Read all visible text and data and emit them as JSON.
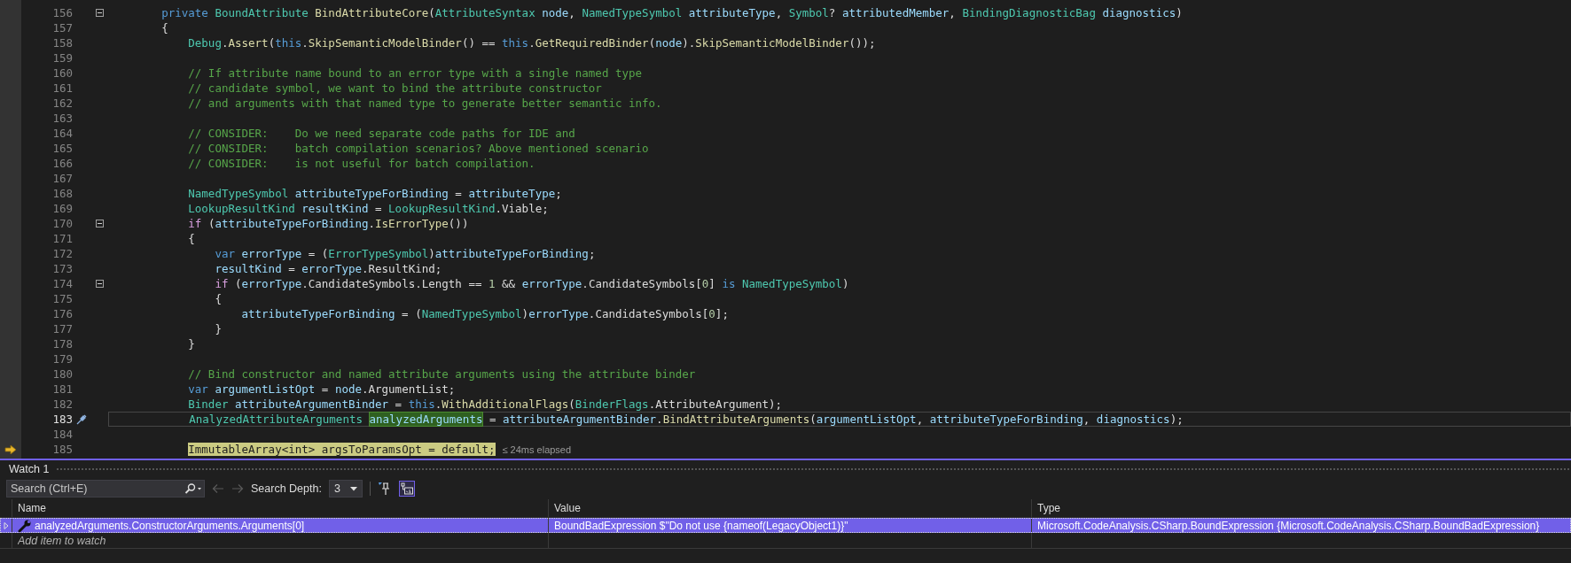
{
  "editor": {
    "lines": [
      {
        "number": "156",
        "kind": "fold",
        "tokens": [
          {
            "kind": "keyword",
            "text": "        private"
          },
          {
            "kind": "type",
            "text": " BoundAttribute"
          },
          {
            "kind": "method",
            "text": " BindAttributeCore"
          },
          {
            "kind": "plain",
            "text": "("
          },
          {
            "kind": "type",
            "text": "AttributeSyntax"
          },
          {
            "kind": "local",
            "text": " node"
          },
          {
            "kind": "plain",
            "text": ", "
          },
          {
            "kind": "type",
            "text": "NamedTypeSymbol"
          },
          {
            "kind": "local",
            "text": " attributeType"
          },
          {
            "kind": "plain",
            "text": ", "
          },
          {
            "kind": "type",
            "text": "Symbol"
          },
          {
            "kind": "plain",
            "text": "? "
          },
          {
            "kind": "local",
            "text": "attributedMember"
          },
          {
            "kind": "plain",
            "text": ", "
          },
          {
            "kind": "type",
            "text": "BindingDiagnosticBag"
          },
          {
            "kind": "local",
            "text": " diagnostics"
          },
          {
            "kind": "plain",
            "text": ")"
          }
        ]
      },
      {
        "number": "157",
        "kind": "plain",
        "tokens": [
          {
            "kind": "plain",
            "text": "        {"
          }
        ]
      },
      {
        "number": "158",
        "kind": "plain",
        "tokens": [
          {
            "kind": "type",
            "text": "            Debug"
          },
          {
            "kind": "plain",
            "text": "."
          },
          {
            "kind": "method",
            "text": "Assert"
          },
          {
            "kind": "plain",
            "text": "("
          },
          {
            "kind": "keyword",
            "text": "this"
          },
          {
            "kind": "plain",
            "text": "."
          },
          {
            "kind": "method",
            "text": "SkipSemanticModelBinder"
          },
          {
            "kind": "plain",
            "text": "() == "
          },
          {
            "kind": "keyword",
            "text": "this"
          },
          {
            "kind": "plain",
            "text": "."
          },
          {
            "kind": "method",
            "text": "GetRequiredBinder"
          },
          {
            "kind": "plain",
            "text": "("
          },
          {
            "kind": "local",
            "text": "node"
          },
          {
            "kind": "plain",
            "text": ")."
          },
          {
            "kind": "method",
            "text": "SkipSemanticModelBinder"
          },
          {
            "kind": "plain",
            "text": "());"
          }
        ]
      },
      {
        "number": "159",
        "kind": "plain"
      },
      {
        "number": "160",
        "kind": "plain",
        "tokens": [
          {
            "kind": "comment",
            "text": "            // If attribute name bound to an error type with a single named type"
          }
        ]
      },
      {
        "number": "161",
        "kind": "plain",
        "tokens": [
          {
            "kind": "comment",
            "text": "            // candidate symbol, we want to bind the attribute constructor"
          }
        ]
      },
      {
        "number": "162",
        "kind": "plain",
        "tokens": [
          {
            "kind": "comment",
            "text": "            // and arguments with that named type to generate better semantic info."
          }
        ]
      },
      {
        "number": "163",
        "kind": "plain"
      },
      {
        "number": "164",
        "kind": "plain",
        "tokens": [
          {
            "kind": "comment",
            "text": "            // CONSIDER:    Do we need separate code paths for IDE and"
          }
        ]
      },
      {
        "number": "165",
        "kind": "plain",
        "tokens": [
          {
            "kind": "comment",
            "text": "            // CONSIDER:    batch compilation scenarios? Above mentioned scenario"
          }
        ]
      },
      {
        "number": "166",
        "kind": "plain",
        "tokens": [
          {
            "kind": "comment",
            "text": "            // CONSIDER:    is not useful for batch compilation."
          }
        ]
      },
      {
        "number": "167",
        "kind": "plain"
      },
      {
        "number": "168",
        "kind": "plain",
        "tokens": [
          {
            "kind": "type",
            "text": "            NamedTypeSymbol"
          },
          {
            "kind": "local",
            "text": " attributeTypeForBinding"
          },
          {
            "kind": "plain",
            "text": " = "
          },
          {
            "kind": "local",
            "text": "attributeType"
          },
          {
            "kind": "plain",
            "text": ";"
          }
        ]
      },
      {
        "number": "169",
        "kind": "plain",
        "tokens": [
          {
            "kind": "type",
            "text": "            LookupResultKind"
          },
          {
            "kind": "local",
            "text": " resultKind"
          },
          {
            "kind": "plain",
            "text": " = "
          },
          {
            "kind": "type",
            "text": "LookupResultKind"
          },
          {
            "kind": "plain",
            "text": ".Viable;"
          }
        ]
      },
      {
        "number": "170",
        "kind": "fold",
        "tokens": [
          {
            "kind": "control",
            "text": "            if"
          },
          {
            "kind": "plain",
            "text": " ("
          },
          {
            "kind": "local",
            "text": "attributeTypeForBinding"
          },
          {
            "kind": "plain",
            "text": "."
          },
          {
            "kind": "method",
            "text": "IsErrorType"
          },
          {
            "kind": "plain",
            "text": "())"
          }
        ]
      },
      {
        "number": "171",
        "kind": "plain",
        "tokens": [
          {
            "kind": "plain",
            "text": "            {"
          }
        ]
      },
      {
        "number": "172",
        "kind": "plain",
        "tokens": [
          {
            "kind": "keyword",
            "text": "                var"
          },
          {
            "kind": "local",
            "text": " errorType"
          },
          {
            "kind": "plain",
            "text": " = ("
          },
          {
            "kind": "type",
            "text": "ErrorTypeSymbol"
          },
          {
            "kind": "plain",
            "text": ")"
          },
          {
            "kind": "local",
            "text": "attributeTypeForBinding"
          },
          {
            "kind": "plain",
            "text": ";"
          }
        ]
      },
      {
        "number": "173",
        "kind": "plain",
        "tokens": [
          {
            "kind": "local",
            "text": "                resultKind"
          },
          {
            "kind": "plain",
            "text": " = "
          },
          {
            "kind": "local",
            "text": "errorType"
          },
          {
            "kind": "plain",
            "text": ".ResultKind;"
          }
        ]
      },
      {
        "number": "174",
        "kind": "fold",
        "tokens": [
          {
            "kind": "control",
            "text": "                if"
          },
          {
            "kind": "plain",
            "text": " ("
          },
          {
            "kind": "local",
            "text": "errorType"
          },
          {
            "kind": "plain",
            "text": ".CandidateSymbols.Length == "
          },
          {
            "kind": "number",
            "text": "1"
          },
          {
            "kind": "plain",
            "text": " && "
          },
          {
            "kind": "local",
            "text": "errorType"
          },
          {
            "kind": "plain",
            "text": ".CandidateSymbols["
          },
          {
            "kind": "number",
            "text": "0"
          },
          {
            "kind": "plain",
            "text": "] "
          },
          {
            "kind": "keyword",
            "text": "is"
          },
          {
            "kind": "type",
            "text": " NamedTypeSymbol"
          },
          {
            "kind": "plain",
            "text": ")"
          }
        ]
      },
      {
        "number": "175",
        "kind": "plain",
        "tokens": [
          {
            "kind": "plain",
            "text": "                {"
          }
        ]
      },
      {
        "number": "176",
        "kind": "plain",
        "tokens": [
          {
            "kind": "local",
            "text": "                    attributeTypeForBinding"
          },
          {
            "kind": "plain",
            "text": " = ("
          },
          {
            "kind": "type",
            "text": "NamedTypeSymbol"
          },
          {
            "kind": "plain",
            "text": ")"
          },
          {
            "kind": "local",
            "text": "errorType"
          },
          {
            "kind": "plain",
            "text": ".CandidateSymbols["
          },
          {
            "kind": "number",
            "text": "0"
          },
          {
            "kind": "plain",
            "text": "];"
          }
        ]
      },
      {
        "number": "177",
        "kind": "plain",
        "tokens": [
          {
            "kind": "plain",
            "text": "                }"
          }
        ]
      },
      {
        "number": "178",
        "kind": "plain",
        "tokens": [
          {
            "kind": "plain",
            "text": "            }"
          }
        ]
      },
      {
        "number": "179",
        "kind": "plain"
      },
      {
        "number": "180",
        "kind": "plain",
        "tokens": [
          {
            "kind": "comment",
            "text": "            // Bind constructor and named attribute arguments using the attribute binder"
          }
        ]
      },
      {
        "number": "181",
        "kind": "plain",
        "tokens": [
          {
            "kind": "keyword",
            "text": "            var"
          },
          {
            "kind": "local",
            "text": " argumentListOpt"
          },
          {
            "kind": "plain",
            "text": " = "
          },
          {
            "kind": "local",
            "text": "node"
          },
          {
            "kind": "plain",
            "text": ".ArgumentList;"
          }
        ]
      },
      {
        "number": "182",
        "kind": "plain",
        "tokens": [
          {
            "kind": "type",
            "text": "            Binder"
          },
          {
            "kind": "local",
            "text": " attributeArgumentBinder"
          },
          {
            "kind": "plain",
            "text": " = "
          },
          {
            "kind": "keyword",
            "text": "this"
          },
          {
            "kind": "plain",
            "text": "."
          },
          {
            "kind": "method",
            "text": "WithAdditionalFlags"
          },
          {
            "kind": "plain",
            "text": "("
          },
          {
            "kind": "type",
            "text": "BinderFlags"
          },
          {
            "kind": "plain",
            "text": ".AttributeArgument);"
          }
        ]
      },
      {
        "number": "183",
        "kind": "current",
        "tokens": [
          {
            "kind": "type",
            "text": "            AnalyzedAttributeArguments "
          },
          {
            "kind": "reference",
            "text": "analyzedArguments"
          },
          {
            "kind": "plain",
            "text": " = "
          },
          {
            "kind": "local",
            "text": "attributeArgumentBinder"
          },
          {
            "kind": "plain",
            "text": "."
          },
          {
            "kind": "method",
            "text": "BindAttributeArguments"
          },
          {
            "kind": "plain",
            "text": "("
          },
          {
            "kind": "local",
            "text": "argumentListOpt"
          },
          {
            "kind": "plain",
            "text": ", "
          },
          {
            "kind": "local",
            "text": "attributeTypeForBinding"
          },
          {
            "kind": "plain",
            "text": ", "
          },
          {
            "kind": "local",
            "text": "diagnostics"
          },
          {
            "kind": "plain",
            "text": ");"
          }
        ]
      },
      {
        "number": "184",
        "kind": "plain"
      },
      {
        "number": "185",
        "kind": "execution",
        "hint": "≤ 24ms elapsed",
        "tokens": [
          {
            "kind": "type",
            "text": "            ImmutableArray"
          },
          {
            "kind": "plain",
            "text": "<"
          },
          {
            "kind": "keyword",
            "text": "int"
          },
          {
            "kind": "plain",
            "text": "> "
          },
          {
            "kind": "local",
            "text": "argsToParamsOpt"
          },
          {
            "kind": "plain",
            "text": " = "
          },
          {
            "kind": "keyword",
            "text": "default"
          },
          {
            "kind": "plain",
            "text": ";"
          }
        ]
      }
    ]
  },
  "watch": {
    "title": "Watch 1",
    "search": {
      "placeholder": "Search (Ctrl+E)"
    },
    "history_disabled": true,
    "search_depth": {
      "label": "Search Depth:",
      "value": "3"
    },
    "raw_view_toggle": {
      "selected": true
    },
    "columns": [
      "Name",
      "Value",
      "Type"
    ],
    "rows": [
      {
        "name": "analyzedArguments.ConstructorArguments.Arguments[0]",
        "value": "BoundBadExpression $\"Do not use {nameof(LegacyObject1)}\"",
        "type": "Microsoft.CodeAnalysis.CSharp.BoundExpression {Microsoft.CodeAnalysis.CSharp.BoundBadExpression}",
        "selected": true,
        "expanded": false
      }
    ],
    "add_item": {
      "placeholder": "Add item to watch"
    }
  }
}
